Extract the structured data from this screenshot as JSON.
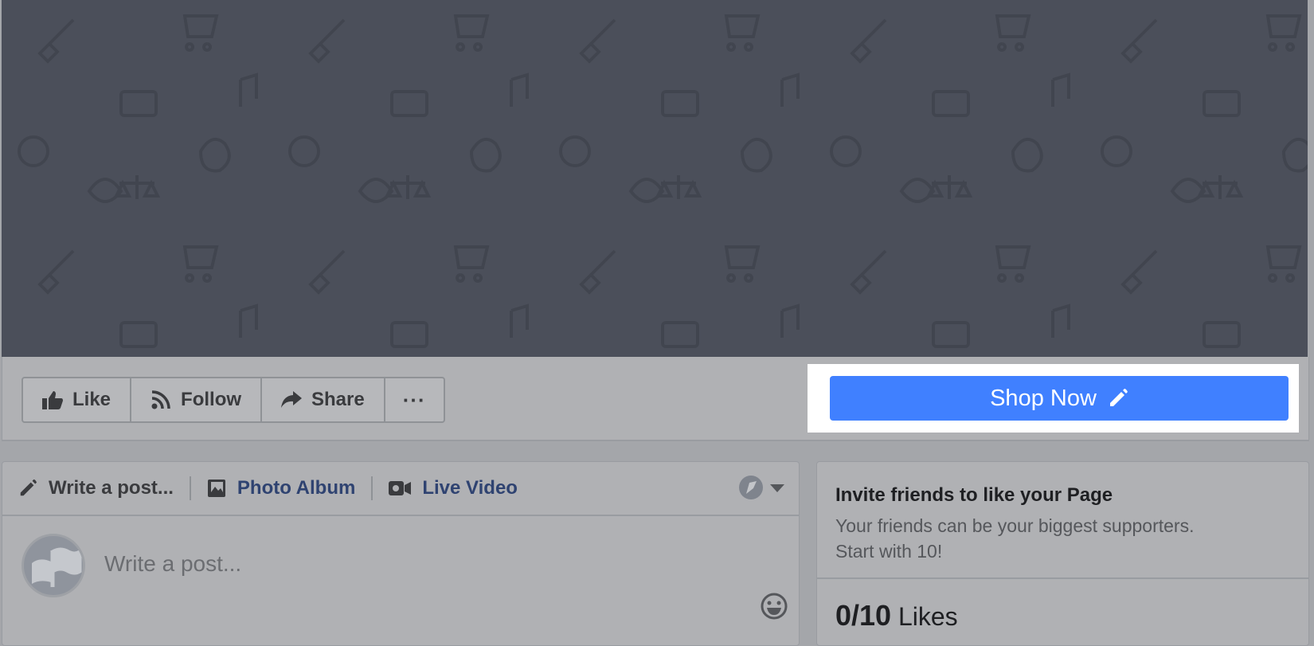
{
  "actions": {
    "like": "Like",
    "follow": "Follow",
    "share": "Share",
    "more": "···"
  },
  "cta": {
    "label": "Shop Now",
    "color": "#4080ff"
  },
  "composer": {
    "tabs": {
      "write": "Write a post...",
      "photo_album": "Photo Album",
      "live_video": "Live Video"
    },
    "placeholder": "Write a post..."
  },
  "invite": {
    "title": "Invite friends to like your Page",
    "line1": "Your friends can be your biggest supporters.",
    "line2": "Start with 10!",
    "count": "0/10",
    "count_label": "Likes"
  },
  "icons": [
    "thumbs-up-icon",
    "rss-icon",
    "share-arrow-icon",
    "more-icon",
    "pencil-icon",
    "photo-album-icon",
    "video-camera-icon",
    "audience-globe-icon",
    "dropdown-caret-icon",
    "flag-avatar-icon",
    "emoji-icon"
  ]
}
